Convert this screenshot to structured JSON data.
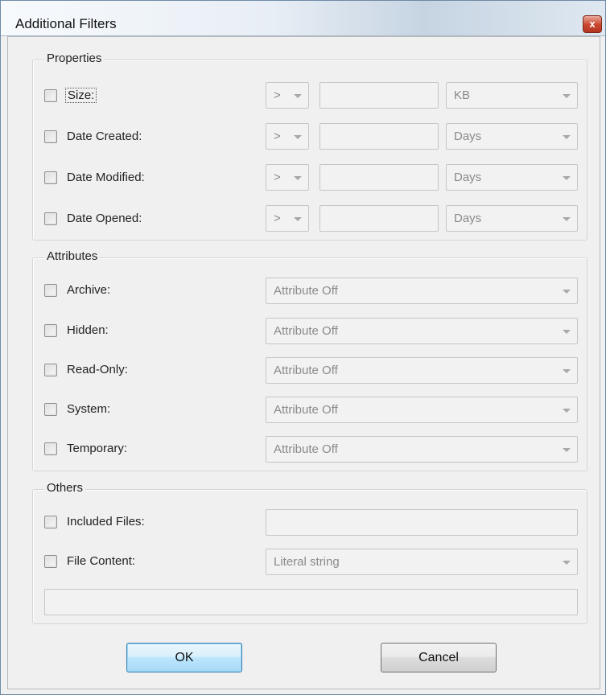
{
  "window": {
    "title": "Additional Filters",
    "close_glyph": "x"
  },
  "properties": {
    "title": "Properties",
    "rows": [
      {
        "label": "Size:",
        "operator": ">",
        "unit": "KB"
      },
      {
        "label": "Date Created:",
        "operator": ">",
        "unit": "Days"
      },
      {
        "label": "Date Modified:",
        "operator": ">",
        "unit": "Days"
      },
      {
        "label": "Date Opened:",
        "operator": ">",
        "unit": "Days"
      }
    ]
  },
  "attributes": {
    "title": "Attributes",
    "rows": [
      {
        "label": "Archive:",
        "value": "Attribute Off"
      },
      {
        "label": "Hidden:",
        "value": "Attribute Off"
      },
      {
        "label": "Read-Only:",
        "value": "Attribute Off"
      },
      {
        "label": "System:",
        "value": "Attribute Off"
      },
      {
        "label": "Temporary:",
        "value": "Attribute Off"
      }
    ]
  },
  "others": {
    "title": "Others",
    "included_files_label": "Included Files:",
    "file_content_label": "File Content:",
    "file_content_mode": "Literal string"
  },
  "buttons": {
    "ok": "OK",
    "cancel": "Cancel"
  }
}
